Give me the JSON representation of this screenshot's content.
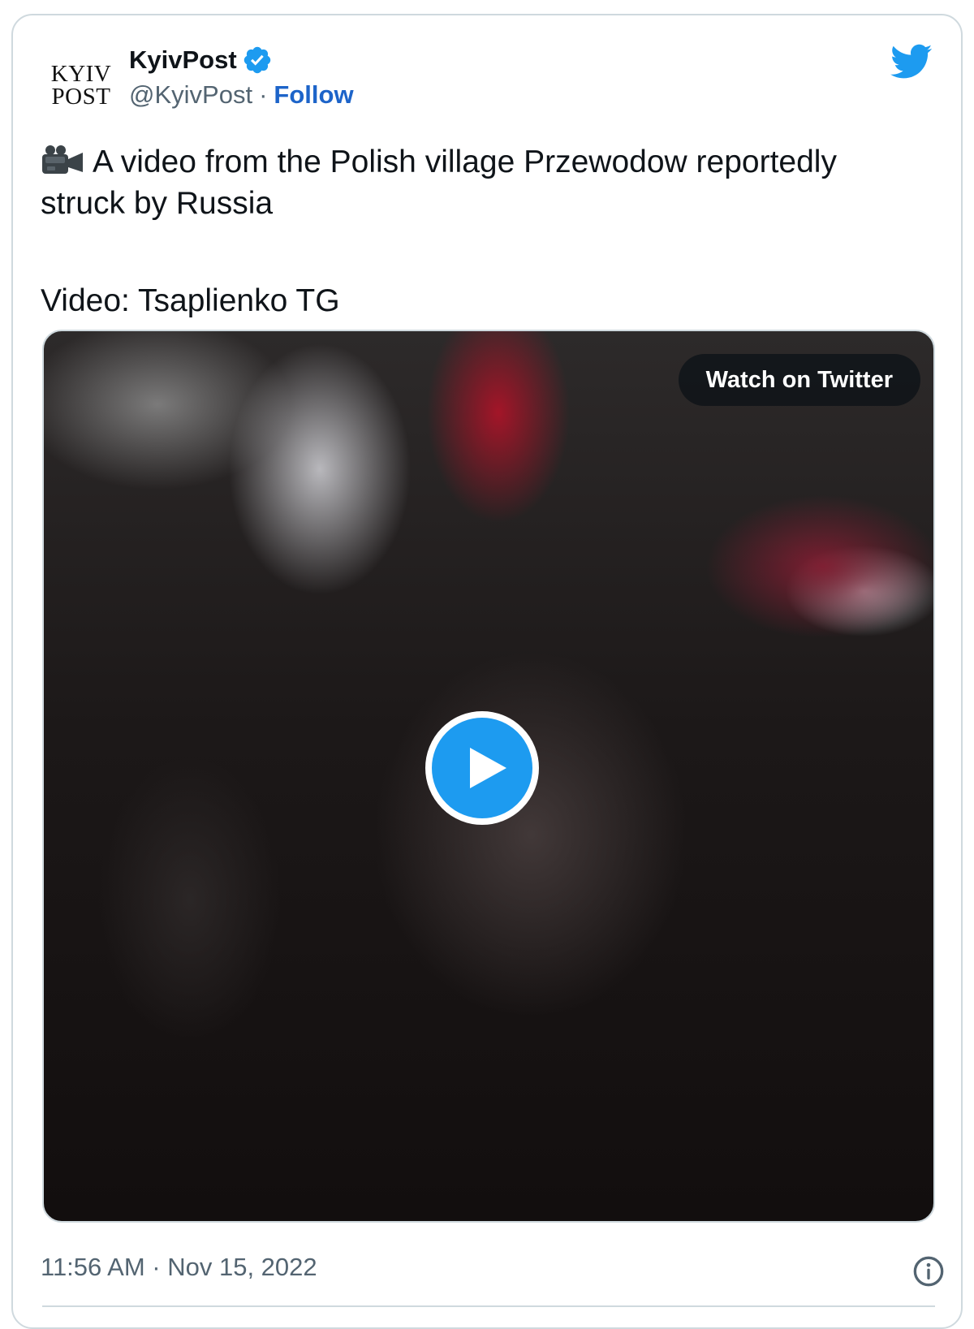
{
  "author": {
    "avatar_line1": "KYIV",
    "avatar_line2": "POST",
    "name": "KyivPost",
    "handle": "@KyivPost",
    "separator": "·",
    "follow_label": "Follow"
  },
  "tweet": {
    "text_line1": "A video from the Polish village Przewodow reportedly",
    "text_line2": "struck by Russia",
    "credit": "Video: Tsaplienko TG",
    "timestamp": "11:56 AM · Nov 15, 2022"
  },
  "media": {
    "watch_label": "Watch on Twitter"
  },
  "colors": {
    "accent": "#1d9bf0",
    "follow": "#1d64c9",
    "text": "#0f1419",
    "muted": "#536471"
  },
  "icons": [
    "verified-badge-icon",
    "twitter-bird-icon",
    "video-camera-icon",
    "play-icon",
    "info-icon"
  ]
}
